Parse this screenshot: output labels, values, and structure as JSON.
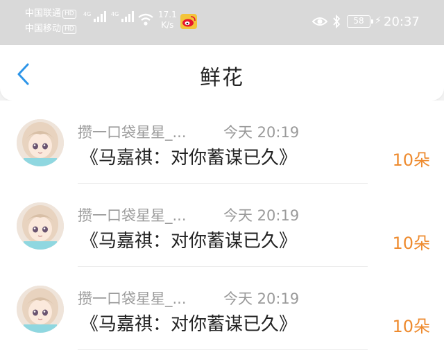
{
  "status_bar": {
    "carrier1": "中国联通",
    "carrier2": "中国移动",
    "hd": "HD",
    "net1": "4G",
    "net2": "4G",
    "speed_value": "17.1",
    "speed_unit": "K/s",
    "battery": "58",
    "time": "20:37"
  },
  "header": {
    "title": "鲜花"
  },
  "colors": {
    "accent": "#2d95e8",
    "count": "#ee8b2f"
  },
  "items": [
    {
      "sender": "攒一口袋星星_...",
      "time": "今天 20:19",
      "gift": "《马嘉祺：对你蓄谋已久》",
      "count": "10朵"
    },
    {
      "sender": "攒一口袋星星_...",
      "time": "今天 20:19",
      "gift": "《马嘉祺：对你蓄谋已久》",
      "count": "10朵"
    },
    {
      "sender": "攒一口袋星星_...",
      "time": "今天 20:19",
      "gift": "《马嘉祺：对你蓄谋已久》",
      "count": "10朵"
    }
  ]
}
